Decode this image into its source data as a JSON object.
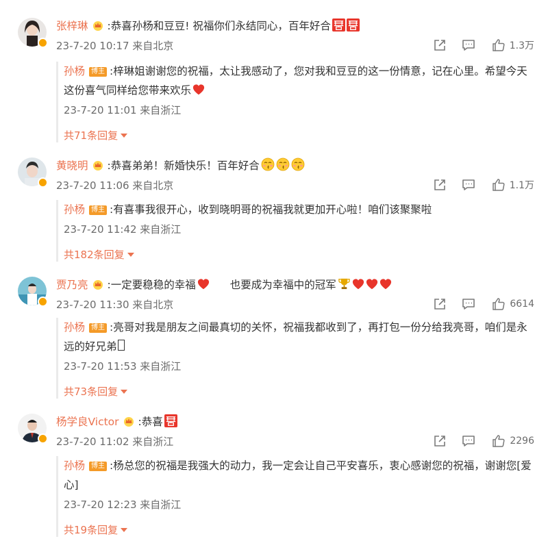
{
  "comments": [
    {
      "user": "张梓琳",
      "text": ":恭喜孙杨和豆豆! 祝福你们永结同心，百年好合",
      "meta": "23-7-20 10:17 来自北京",
      "likes": "1.3万",
      "reply": {
        "name": "孙杨",
        "badge": "博主",
        "text": ":梓琳姐谢谢您的祝福，太让我感动了，您对我和豆豆的这一份情意，记在心里。希望今天这份喜气同样给您带来欢乐",
        "meta": "23-7-20 11:01 来自浙江"
      },
      "more": "共71条回复"
    },
    {
      "user": "黄晓明",
      "text": ":恭喜弟弟！新婚快乐！百年好合",
      "meta": "23-7-20 11:06 来自北京",
      "likes": "1.1万",
      "reply": {
        "name": "孙杨",
        "badge": "博主",
        "text": ":有喜事我很开心，收到晓明哥的祝福我就更加开心啦！咱们该聚聚啦",
        "meta": "23-7-20 11:42 来自浙江"
      },
      "more": "共182条回复"
    },
    {
      "user": "贾乃亮",
      "text": ":一定要稳稳的幸福",
      "text2": "也要成为幸福中的冠军",
      "meta": "23-7-20 11:30 来自北京",
      "likes": "6614",
      "reply": {
        "name": "孙杨",
        "badge": "博主",
        "text": ":亮哥对我是朋友之间最真切的关怀，祝福我都收到了，再打包一份分给我亮哥，咱们是永远的好兄弟",
        "meta": "23-7-20 11:53 来自浙江"
      },
      "more": "共73条回复"
    },
    {
      "user": "杨学良Victor",
      "text": ":恭喜",
      "meta": "23-7-20 11:02 来自浙江",
      "likes": "2296",
      "reply": {
        "name": "孙杨",
        "badge": "博主",
        "text": ":杨总您的祝福是我强大的动力，我一定会让自己平安喜乐，衷心感谢您的祝福，谢谢您[爱心]",
        "meta": "23-7-20 12:23 来自浙江"
      },
      "more": "共19条回复"
    }
  ],
  "colors": {
    "username": "#eb7350",
    "badge": "#f49a28",
    "meta": "#6b6b6b"
  },
  "icons": [
    "share-icon",
    "comment-icon",
    "like-icon",
    "crown-icon",
    "heart-emoji",
    "double-happiness-emoji",
    "trophy-emoji"
  ]
}
